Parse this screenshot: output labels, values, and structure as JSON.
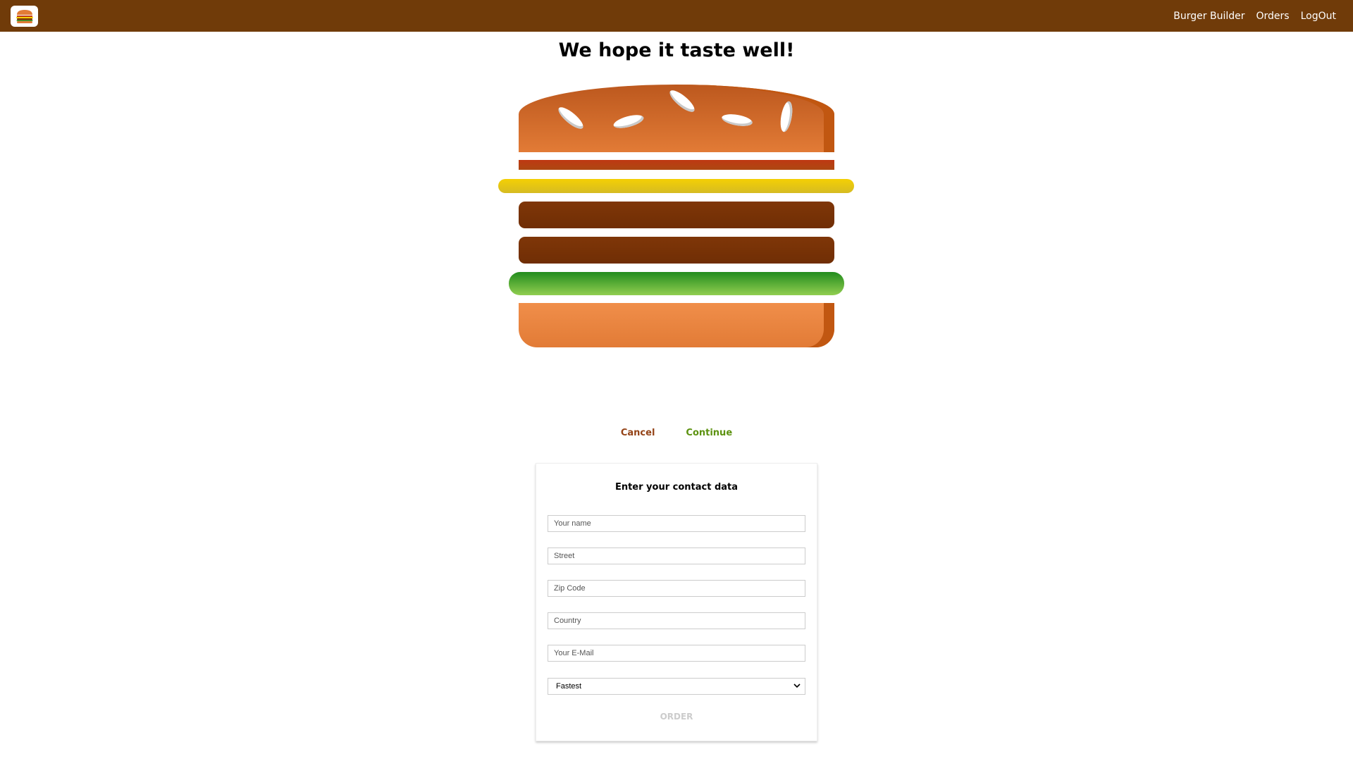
{
  "nav": {
    "logo_icon": "burger-logo-icon",
    "items": [
      {
        "label": "Burger Builder"
      },
      {
        "label": "Orders"
      },
      {
        "label": "LogOut"
      }
    ]
  },
  "checkout": {
    "title": "We hope it taste well!",
    "ingredients": [
      "bacon",
      "cheese",
      "meat",
      "meat",
      "salad"
    ],
    "cancel_label": "Cancel",
    "continue_label": "Continue"
  },
  "contact": {
    "heading": "Enter your contact data",
    "fields": {
      "name_placeholder": "Your name",
      "street_placeholder": "Street",
      "zip_placeholder": "Zip Code",
      "country_placeholder": "Country",
      "email_placeholder": "Your E-Mail"
    },
    "delivery_method": {
      "selected": "Fastest"
    },
    "order_label": "ORDER"
  },
  "colors": {
    "toolbar": "#703b09",
    "cancel": "#944317",
    "continue": "#5c9210",
    "order_disabled": "#cccccc"
  }
}
